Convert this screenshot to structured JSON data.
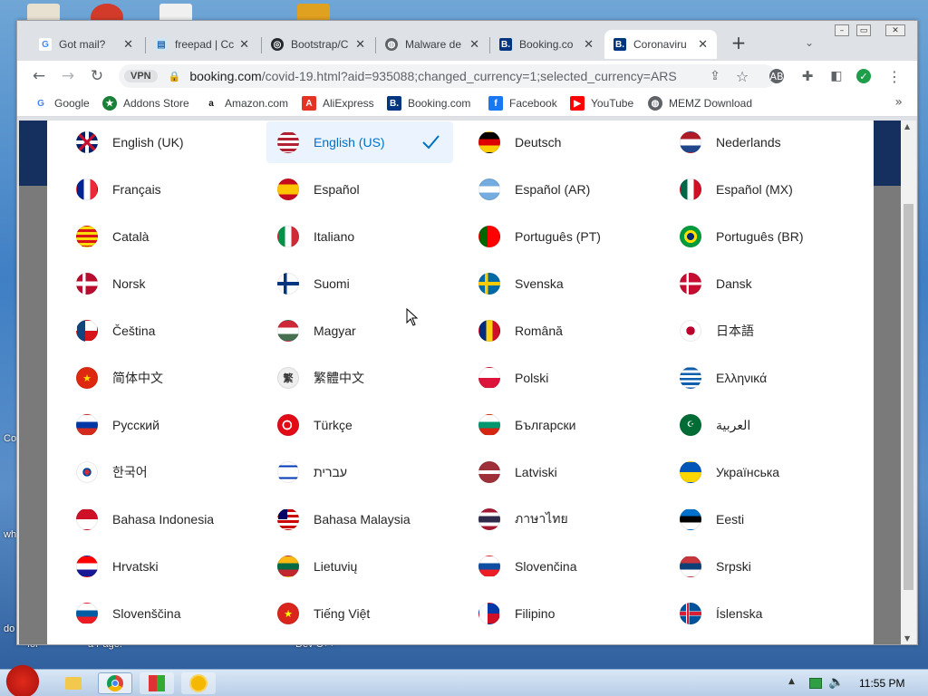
{
  "desktop": {
    "left_texts": [
      "Co",
      "wh",
      "do"
    ],
    "bottom_texts": [
      "for",
      "a Page.",
      "Dev C++"
    ]
  },
  "tabs": [
    {
      "title": "Got mail?",
      "icon": "google-icon",
      "active": false
    },
    {
      "title": "freepad | Cc",
      "icon": "freepad-icon",
      "active": false
    },
    {
      "title": "Bootstrap/C",
      "icon": "github-icon",
      "active": false
    },
    {
      "title": "Malware de",
      "icon": "globe-icon",
      "active": false
    },
    {
      "title": "Booking.co",
      "icon": "booking-icon",
      "active": false
    },
    {
      "title": "Coronaviru",
      "icon": "booking-icon",
      "active": true
    }
  ],
  "omnibox": {
    "vpn_label": "VPN",
    "domain": "booking.com",
    "path": "/covid-19.html?aid=935088;changed_currency=1;selected_currency=ARS"
  },
  "bookmarks": [
    {
      "label": "Google",
      "icon": "google-icon",
      "color": "#ffffff"
    },
    {
      "label": "Addons Store",
      "icon": "addons-icon",
      "color": "#1a7f37"
    },
    {
      "label": "Amazon.com",
      "icon": "amazon-icon",
      "color": "#ffffff"
    },
    {
      "label": "AliExpress",
      "icon": "aliexpress-icon",
      "color": "#e43225"
    },
    {
      "label": "Booking.com",
      "icon": "booking-icon",
      "color": "#003580"
    },
    {
      "label": "Facebook",
      "icon": "facebook-icon",
      "color": "#1877f2"
    },
    {
      "label": "YouTube",
      "icon": "youtube-icon",
      "color": "#ff0000"
    },
    {
      "label": "MEMZ Download",
      "icon": "globe-icon",
      "color": "#5f6368"
    }
  ],
  "languages": [
    {
      "label": "English (UK)",
      "flag": "uk",
      "selected": false
    },
    {
      "label": "English (US)",
      "flag": "us",
      "selected": true
    },
    {
      "label": "Deutsch",
      "flag": "de",
      "selected": false
    },
    {
      "label": "Nederlands",
      "flag": "nl",
      "selected": false
    },
    {
      "label": "Français",
      "flag": "fr",
      "selected": false
    },
    {
      "label": "Español",
      "flag": "es",
      "selected": false
    },
    {
      "label": "Español (AR)",
      "flag": "ar",
      "selected": false
    },
    {
      "label": "Español (MX)",
      "flag": "mx",
      "selected": false
    },
    {
      "label": "Català",
      "flag": "ca",
      "selected": false
    },
    {
      "label": "Italiano",
      "flag": "it",
      "selected": false
    },
    {
      "label": "Português (PT)",
      "flag": "pt",
      "selected": false
    },
    {
      "label": "Português (BR)",
      "flag": "br",
      "selected": false
    },
    {
      "label": "Norsk",
      "flag": "no",
      "selected": false
    },
    {
      "label": "Suomi",
      "flag": "fi",
      "selected": false
    },
    {
      "label": "Svenska",
      "flag": "se",
      "selected": false
    },
    {
      "label": "Dansk",
      "flag": "dk",
      "selected": false
    },
    {
      "label": "Čeština",
      "flag": "cz",
      "selected": false
    },
    {
      "label": "Magyar",
      "flag": "hu",
      "selected": false
    },
    {
      "label": "Română",
      "flag": "ro",
      "selected": false
    },
    {
      "label": "日本語",
      "flag": "jp",
      "selected": false
    },
    {
      "label": "简体中文",
      "flag": "cn",
      "selected": false
    },
    {
      "label": "繁體中文",
      "flag": "tw",
      "selected": false
    },
    {
      "label": "Polski",
      "flag": "pl",
      "selected": false
    },
    {
      "label": "Ελληνικά",
      "flag": "gr",
      "selected": false
    },
    {
      "label": "Русский",
      "flag": "ru",
      "selected": false
    },
    {
      "label": "Türkçe",
      "flag": "tr",
      "selected": false
    },
    {
      "label": "Български",
      "flag": "bg",
      "selected": false
    },
    {
      "label": "العربية",
      "flag": "sa",
      "selected": false
    },
    {
      "label": "한국어",
      "flag": "kr",
      "selected": false
    },
    {
      "label": "עברית",
      "flag": "il",
      "selected": false
    },
    {
      "label": "Latviski",
      "flag": "lv",
      "selected": false
    },
    {
      "label": "Українська",
      "flag": "ua",
      "selected": false
    },
    {
      "label": "Bahasa Indonesia",
      "flag": "id",
      "selected": false
    },
    {
      "label": "Bahasa Malaysia",
      "flag": "my",
      "selected": false
    },
    {
      "label": "ภาษาไทย",
      "flag": "th",
      "selected": false
    },
    {
      "label": "Eesti",
      "flag": "ee",
      "selected": false
    },
    {
      "label": "Hrvatski",
      "flag": "hr",
      "selected": false
    },
    {
      "label": "Lietuvių",
      "flag": "lt",
      "selected": false
    },
    {
      "label": "Slovenčina",
      "flag": "sk",
      "selected": false
    },
    {
      "label": "Srpski",
      "flag": "rs",
      "selected": false
    },
    {
      "label": "Slovenščina",
      "flag": "si",
      "selected": false
    },
    {
      "label": "Tiếng Việt",
      "flag": "vn",
      "selected": false
    },
    {
      "label": "Filipino",
      "flag": "ph",
      "selected": false
    },
    {
      "label": "Íslenska",
      "flag": "is",
      "selected": false
    }
  ],
  "taskbar": {
    "clock": "11:55 PM"
  },
  "colors": {
    "selected_bg": "#ebf3ff",
    "selected_text": "#0071c2",
    "booking_blue": "#003580"
  }
}
